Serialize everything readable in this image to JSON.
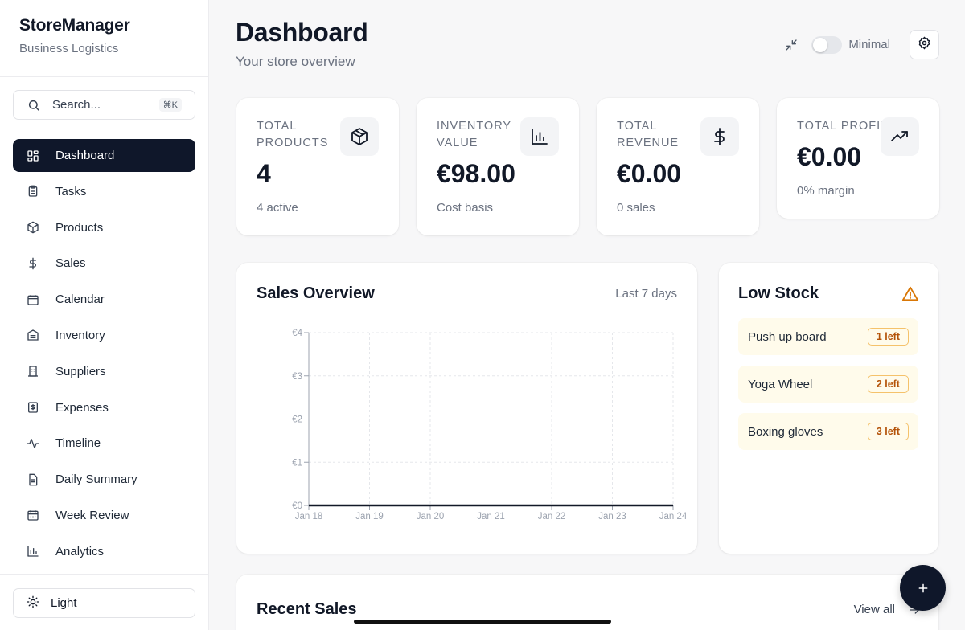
{
  "brand": {
    "title": "StoreManager",
    "subtitle": "Business Logistics"
  },
  "search": {
    "placeholder": "Search...",
    "shortcut": "⌘K",
    "icon": "search-icon"
  },
  "nav": [
    {
      "label": "Dashboard",
      "icon": "dashboard-icon",
      "active": true
    },
    {
      "label": "Tasks",
      "icon": "clipboard-icon"
    },
    {
      "label": "Products",
      "icon": "box-icon"
    },
    {
      "label": "Sales",
      "icon": "dollar-icon"
    },
    {
      "label": "Calendar",
      "icon": "calendar-icon"
    },
    {
      "label": "Inventory",
      "icon": "warehouse-icon"
    },
    {
      "label": "Suppliers",
      "icon": "building-icon"
    },
    {
      "label": "Expenses",
      "icon": "receipt-icon"
    },
    {
      "label": "Timeline",
      "icon": "activity-icon"
    },
    {
      "label": "Daily Summary",
      "icon": "document-icon"
    },
    {
      "label": "Week Review",
      "icon": "calendar-grid-icon"
    },
    {
      "label": "Analytics",
      "icon": "bar-chart-icon"
    }
  ],
  "theme": {
    "label": "Light",
    "icon": "sun-icon"
  },
  "header": {
    "title": "Dashboard",
    "subtitle": "Your store overview",
    "toggle_label": "Minimal",
    "toggle_on": false
  },
  "stats": [
    {
      "label": "Total Products",
      "value": "4",
      "foot": "4 active",
      "icon": "box-icon"
    },
    {
      "label": "Inventory Value",
      "value": "€98.00",
      "foot": "Cost basis",
      "icon": "bar-chart-icon"
    },
    {
      "label": "Total Revenue",
      "value": "€0.00",
      "foot": "0 sales",
      "icon": "dollar-icon"
    },
    {
      "label": "Total Profit",
      "value": "€0.00",
      "foot": "0% margin",
      "icon": "trending-up-icon"
    }
  ],
  "sales_overview": {
    "title": "Sales Overview",
    "range": "Last 7 days"
  },
  "chart_data": {
    "type": "line",
    "title": "",
    "x": [
      "Jan 18",
      "Jan 19",
      "Jan 20",
      "Jan 21",
      "Jan 22",
      "Jan 23",
      "Jan 24"
    ],
    "series": [
      {
        "values": [
          0,
          0,
          0,
          0,
          0,
          0,
          0
        ]
      }
    ],
    "y_ticks": [
      "€0",
      "€1",
      "€2",
      "€3",
      "€4"
    ],
    "ylim": [
      0,
      4
    ],
    "grid": true,
    "line_color": "#111827"
  },
  "low_stock": {
    "title": "Low Stock",
    "items": [
      {
        "name": "Push up board",
        "badge": "1 left"
      },
      {
        "name": "Yoga Wheel",
        "badge": "2 left"
      },
      {
        "name": "Boxing gloves",
        "badge": "3 left"
      }
    ]
  },
  "recent_sales": {
    "title": "Recent Sales",
    "view_all": "View all"
  },
  "colors": {
    "accent": "#0f172a",
    "warning": "#d97706",
    "warning_bg": "#fffbeb"
  }
}
